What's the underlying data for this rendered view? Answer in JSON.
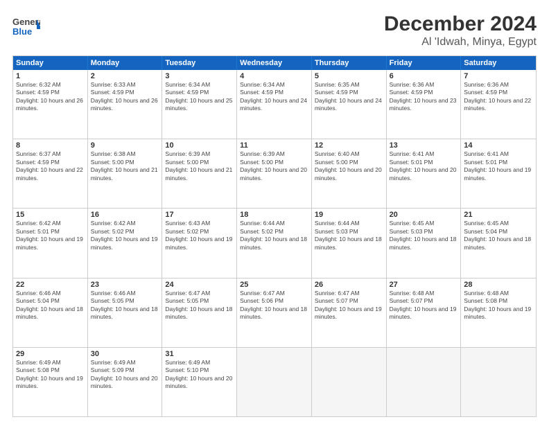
{
  "header": {
    "logo_line1": "General",
    "logo_line2": "Blue",
    "month": "December 2024",
    "location": "Al 'Idwah, Minya, Egypt"
  },
  "days_of_week": [
    "Sunday",
    "Monday",
    "Tuesday",
    "Wednesday",
    "Thursday",
    "Friday",
    "Saturday"
  ],
  "weeks": [
    [
      {
        "day": "1",
        "sunrise": "Sunrise: 6:32 AM",
        "sunset": "Sunset: 4:59 PM",
        "daylight": "Daylight: 10 hours and 26 minutes."
      },
      {
        "day": "2",
        "sunrise": "Sunrise: 6:33 AM",
        "sunset": "Sunset: 4:59 PM",
        "daylight": "Daylight: 10 hours and 26 minutes."
      },
      {
        "day": "3",
        "sunrise": "Sunrise: 6:34 AM",
        "sunset": "Sunset: 4:59 PM",
        "daylight": "Daylight: 10 hours and 25 minutes."
      },
      {
        "day": "4",
        "sunrise": "Sunrise: 6:34 AM",
        "sunset": "Sunset: 4:59 PM",
        "daylight": "Daylight: 10 hours and 24 minutes."
      },
      {
        "day": "5",
        "sunrise": "Sunrise: 6:35 AM",
        "sunset": "Sunset: 4:59 PM",
        "daylight": "Daylight: 10 hours and 24 minutes."
      },
      {
        "day": "6",
        "sunrise": "Sunrise: 6:36 AM",
        "sunset": "Sunset: 4:59 PM",
        "daylight": "Daylight: 10 hours and 23 minutes."
      },
      {
        "day": "7",
        "sunrise": "Sunrise: 6:36 AM",
        "sunset": "Sunset: 4:59 PM",
        "daylight": "Daylight: 10 hours and 22 minutes."
      }
    ],
    [
      {
        "day": "8",
        "sunrise": "Sunrise: 6:37 AM",
        "sunset": "Sunset: 4:59 PM",
        "daylight": "Daylight: 10 hours and 22 minutes."
      },
      {
        "day": "9",
        "sunrise": "Sunrise: 6:38 AM",
        "sunset": "Sunset: 5:00 PM",
        "daylight": "Daylight: 10 hours and 21 minutes."
      },
      {
        "day": "10",
        "sunrise": "Sunrise: 6:39 AM",
        "sunset": "Sunset: 5:00 PM",
        "daylight": "Daylight: 10 hours and 21 minutes."
      },
      {
        "day": "11",
        "sunrise": "Sunrise: 6:39 AM",
        "sunset": "Sunset: 5:00 PM",
        "daylight": "Daylight: 10 hours and 20 minutes."
      },
      {
        "day": "12",
        "sunrise": "Sunrise: 6:40 AM",
        "sunset": "Sunset: 5:00 PM",
        "daylight": "Daylight: 10 hours and 20 minutes."
      },
      {
        "day": "13",
        "sunrise": "Sunrise: 6:41 AM",
        "sunset": "Sunset: 5:01 PM",
        "daylight": "Daylight: 10 hours and 20 minutes."
      },
      {
        "day": "14",
        "sunrise": "Sunrise: 6:41 AM",
        "sunset": "Sunset: 5:01 PM",
        "daylight": "Daylight: 10 hours and 19 minutes."
      }
    ],
    [
      {
        "day": "15",
        "sunrise": "Sunrise: 6:42 AM",
        "sunset": "Sunset: 5:01 PM",
        "daylight": "Daylight: 10 hours and 19 minutes."
      },
      {
        "day": "16",
        "sunrise": "Sunrise: 6:42 AM",
        "sunset": "Sunset: 5:02 PM",
        "daylight": "Daylight: 10 hours and 19 minutes."
      },
      {
        "day": "17",
        "sunrise": "Sunrise: 6:43 AM",
        "sunset": "Sunset: 5:02 PM",
        "daylight": "Daylight: 10 hours and 19 minutes."
      },
      {
        "day": "18",
        "sunrise": "Sunrise: 6:44 AM",
        "sunset": "Sunset: 5:02 PM",
        "daylight": "Daylight: 10 hours and 18 minutes."
      },
      {
        "day": "19",
        "sunrise": "Sunrise: 6:44 AM",
        "sunset": "Sunset: 5:03 PM",
        "daylight": "Daylight: 10 hours and 18 minutes."
      },
      {
        "day": "20",
        "sunrise": "Sunrise: 6:45 AM",
        "sunset": "Sunset: 5:03 PM",
        "daylight": "Daylight: 10 hours and 18 minutes."
      },
      {
        "day": "21",
        "sunrise": "Sunrise: 6:45 AM",
        "sunset": "Sunset: 5:04 PM",
        "daylight": "Daylight: 10 hours and 18 minutes."
      }
    ],
    [
      {
        "day": "22",
        "sunrise": "Sunrise: 6:46 AM",
        "sunset": "Sunset: 5:04 PM",
        "daylight": "Daylight: 10 hours and 18 minutes."
      },
      {
        "day": "23",
        "sunrise": "Sunrise: 6:46 AM",
        "sunset": "Sunset: 5:05 PM",
        "daylight": "Daylight: 10 hours and 18 minutes."
      },
      {
        "day": "24",
        "sunrise": "Sunrise: 6:47 AM",
        "sunset": "Sunset: 5:05 PM",
        "daylight": "Daylight: 10 hours and 18 minutes."
      },
      {
        "day": "25",
        "sunrise": "Sunrise: 6:47 AM",
        "sunset": "Sunset: 5:06 PM",
        "daylight": "Daylight: 10 hours and 18 minutes."
      },
      {
        "day": "26",
        "sunrise": "Sunrise: 6:47 AM",
        "sunset": "Sunset: 5:07 PM",
        "daylight": "Daylight: 10 hours and 19 minutes."
      },
      {
        "day": "27",
        "sunrise": "Sunrise: 6:48 AM",
        "sunset": "Sunset: 5:07 PM",
        "daylight": "Daylight: 10 hours and 19 minutes."
      },
      {
        "day": "28",
        "sunrise": "Sunrise: 6:48 AM",
        "sunset": "Sunset: 5:08 PM",
        "daylight": "Daylight: 10 hours and 19 minutes."
      }
    ],
    [
      {
        "day": "29",
        "sunrise": "Sunrise: 6:49 AM",
        "sunset": "Sunset: 5:08 PM",
        "daylight": "Daylight: 10 hours and 19 minutes."
      },
      {
        "day": "30",
        "sunrise": "Sunrise: 6:49 AM",
        "sunset": "Sunset: 5:09 PM",
        "daylight": "Daylight: 10 hours and 20 minutes."
      },
      {
        "day": "31",
        "sunrise": "Sunrise: 6:49 AM",
        "sunset": "Sunset: 5:10 PM",
        "daylight": "Daylight: 10 hours and 20 minutes."
      },
      {
        "day": "",
        "sunrise": "",
        "sunset": "",
        "daylight": ""
      },
      {
        "day": "",
        "sunrise": "",
        "sunset": "",
        "daylight": ""
      },
      {
        "day": "",
        "sunrise": "",
        "sunset": "",
        "daylight": ""
      },
      {
        "day": "",
        "sunrise": "",
        "sunset": "",
        "daylight": ""
      }
    ]
  ]
}
